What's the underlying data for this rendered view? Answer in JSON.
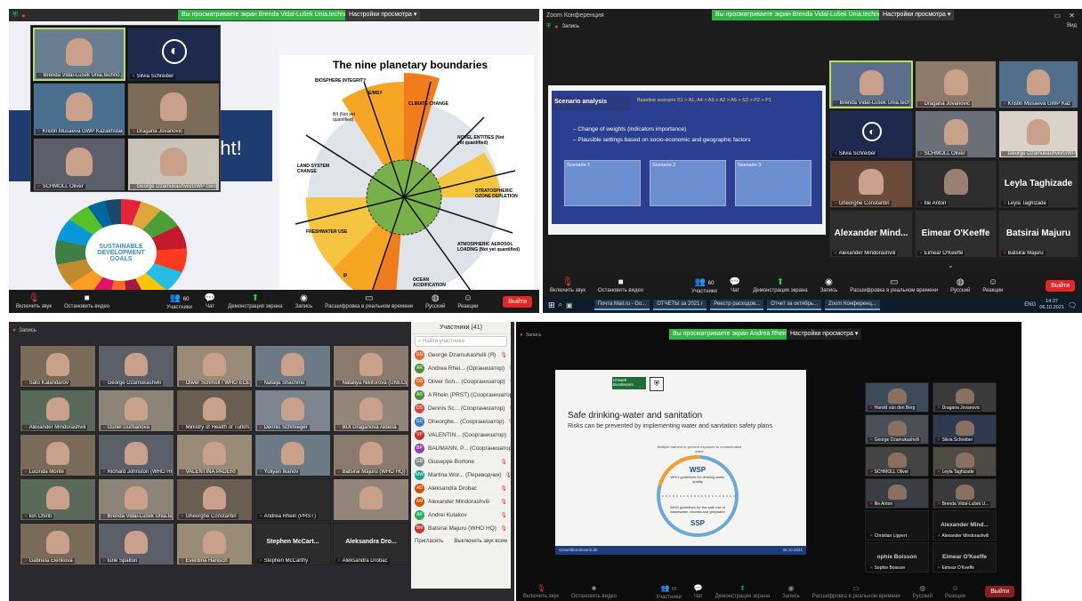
{
  "q1": {
    "share_banner": "Вы просматриваете экран Brenda Vidal-Lušek Unia.techno...",
    "share_settings": "Настройки просмотра ▾",
    "participants": [
      {
        "name": "Brenda Vidal-Lušek Unia.techno..."
      },
      {
        "name": "Silvia Schreiber"
      },
      {
        "name": "Kristin Musaeva GWP Kazakhstan"
      },
      {
        "name": "Dragana Jovanovic"
      },
      {
        "name": "SCHMOLL Oliver"
      },
      {
        "name": "George Dzamukashvili/GWP Geor..."
      }
    ],
    "slide": {
      "title": "The nine planetary boundaries",
      "labels": [
        "BIOSPHERE INTEGRITY",
        "E/MSY",
        "BII (Not yet quantified)",
        "CLIMATE CHANGE",
        "NOVEL ENTITIES (Not yet quantified)",
        "LAND-SYSTEM CHANGE",
        "STRATOSPHERIC OZONE DEPLETION",
        "FRESHWATER USE",
        "ATMOSPHERIC AEROSOL LOADING (Not yet quantified)",
        "OCEAN ACIDIFICATION",
        "P",
        "N"
      ],
      "partial_text": "ght!",
      "sdg": "SUSTAINABLE DEVELOPMENT GOALS"
    },
    "toolbar": {
      "mute": "Включить звук",
      "video": "Остановить видео",
      "participants": "Участники",
      "participants_count": "60",
      "chat": "Чат",
      "share": "Демонстрация экрана",
      "record": "Запись",
      "transcript": "Расшифровка в реальном времени",
      "lang": "Русский",
      "reactions": "Реакции",
      "leave": "Выйти"
    }
  },
  "q2": {
    "title": "Zoom Конференция",
    "share_banner": "Вы просматриваете экран Brenda Vidal-Lušek Unia.techno...",
    "share_settings": "Настройки просмотра ▾",
    "record": "Запись",
    "view": "Вид",
    "slide": {
      "title": "Scenario analysis",
      "baseline": "Baseline scenario S1 > A1, A4 > A3 > A2 > A5 > S2 > P2 > P1",
      "bullets": [
        "Change of weights (indicators importance)",
        "Plausible settings based on socio-economic and geographic factors"
      ],
      "scenarios": [
        "Scenario 1",
        "Scenario 2",
        "Scenario 3"
      ]
    },
    "participants": [
      {
        "name": "Brenda Vidal-Lušek Unia.techno..."
      },
      {
        "name": "Dragana Jovanovic"
      },
      {
        "name": "Kristin Musaeva GWP Kaz"
      },
      {
        "name": "Silvia Schreiber"
      },
      {
        "name": "SCHMOLL Oliver"
      },
      {
        "name": "George Dzamukashvili/GWP..."
      },
      {
        "name": "Gheorghe Constantin"
      },
      {
        "name": "Ilie Anton"
      },
      {
        "name": "Leyla Taghizade",
        "big": "Leyla Taghizade"
      },
      {
        "name": "Alexander Mindorashvili",
        "big": "Alexander Mind..."
      },
      {
        "name": "Eimear O'Keeffe",
        "big": "Eimear O'Keeffe"
      },
      {
        "name": "Batsirai Majuru",
        "big": "Batsirai Majuru"
      }
    ],
    "toolbar": {
      "mute": "Включить звук",
      "video": "Остановить видео",
      "participants": "Участники",
      "participants_count": "60",
      "chat": "Чат",
      "share": "Демонстрация экрана",
      "record": "Запись",
      "transcript": "Расшифровка в реальном времени",
      "lang": "Русский",
      "reactions": "Реакции",
      "leave": "Выйти"
    },
    "taskbar": {
      "apps": [
        "Почта Mail.ru - Go...",
        "ОТЧЕТЫ за 2021 г",
        "Реестр расходов...",
        "Отчет за октябрь...",
        "Zoom Конференц..."
      ],
      "lang": "ENG",
      "time": "14:37",
      "date": "06.10.2021"
    }
  },
  "q3": {
    "record": "Запись",
    "panel_title": "Участники (41)",
    "search_placeholder": "Найти участника",
    "panel_list": [
      {
        "initials": "GD",
        "name": "George Dzamukashvili (Я)",
        "color": "#e06c2c"
      },
      {
        "initials": "AR",
        "name": "Andrea Rhei... (Организатор)",
        "color": "#4a8f3c"
      },
      {
        "initials": "OS",
        "name": "Oliver Sch... (Соорганизатор)",
        "color": "#e06c2c"
      },
      {
        "initials": "AR",
        "name": "A Rhein (PRST) (Соорганизатор)",
        "color": "#4a8f3c"
      },
      {
        "initials": "DS",
        "name": "Dennis Sc... (Соорганизатор)",
        "color": "#d04a4a"
      },
      {
        "initials": "GC",
        "name": "Gheorghe... (Соорганизатор)",
        "color": "#3c7bc4"
      },
      {
        "initials": "VP",
        "name": "VALENTIN... (Соорганизатор)",
        "color": "#c0392b"
      },
      {
        "initials": "BP",
        "name": "BAUMANN, P... (Соорганизатор)",
        "color": "#8e44ad"
      },
      {
        "initials": "GB",
        "name": "Giuseppe Borlone",
        "color": "#7f8c8d"
      },
      {
        "initials": "MW",
        "name": "Martina Wor... (Переводчик)",
        "color": "#16a085"
      },
      {
        "initials": "AD",
        "name": "Aleksandra Drobac",
        "color": "#d35400"
      },
      {
        "initials": "AM",
        "name": "Alexander Mindorashvili",
        "color": "#d35400"
      },
      {
        "initials": "AK",
        "name": "Andrei Kulakov",
        "color": "#27ae60"
      },
      {
        "initials": "BM",
        "name": "Batsirai Majuru (WHO HQ)",
        "color": "#c0392b"
      }
    ],
    "invite": "Пригласить",
    "mute_all": "Выключить звук всем",
    "grid": [
      "Safo Kalandarov",
      "George Dzamukashvili",
      "Oliver Schmoll / WHO ECEH",
      "Natalja Shachmu",
      "Nataliya Nikiforova (UNECE)",
      "Alexander Mindorashvili",
      "Gunel Gurbanova",
      "Ministry of Health of Turkm...",
      "Dennis Schmieger",
      "BUI Draganova Aldena",
      "Lucinda Monte",
      "Richard Johnston (WHO HQ)",
      "VALENTINA PADERI",
      "Yuliyan Ikanov",
      "Batsirai Majuru (WHO HQ)",
      "Ion Chiriti",
      "Brenda Vidal-Lušek Unia.tech...",
      "Gheorghe Constantin",
      "Andrea Rhein (PRST)",
      "",
      "Gabriela Elenkova",
      "Iurie Spalton",
      "Everdina Hanisch",
      "Stephen McCarthy",
      "Aleksandra Drobac"
    ],
    "grid_big": {
      "18": "",
      "23": "Stephen McCart...",
      "24": "Aleksandra Dro..."
    }
  },
  "q4": {
    "share_banner": "Вы просматриваете экран Andrea Rhein",
    "share_settings": "Настройки просмотра ▾",
    "record": "Запись",
    "slide": {
      "logo1": "Umwelt Bundesamt",
      "title": "Safe drinking-water and sanitation",
      "subtitle": "Risks can be prevented by implementing water and sanitation safety plans",
      "cycle_top": "Multiple barriers to prevent exposure to contaminated water",
      "wsp": "WSP",
      "wsp_sub": "WHO guidelines for drinking-water quality",
      "ssp": "SSP",
      "ssp_sub": "WHO guidelines for the safe use of wastewater, excreta and greywater",
      "footer": "Umweltbundesamt.de",
      "page": "25.10.2021"
    },
    "participants": [
      {
        "name": "Harold van den Berg"
      },
      {
        "name": "Dragana Jovanovic"
      },
      {
        "name": "George Dzamukashvili"
      },
      {
        "name": "Silvia Schreiber"
      },
      {
        "name": "SCHMOLL Oliver"
      },
      {
        "name": "Leyla Taghizade"
      },
      {
        "name": "Ilie Anton"
      },
      {
        "name": "Brenda Vidal-Lušek U..."
      },
      {
        "name": "Christian Lippert",
        "big": ""
      },
      {
        "name": "Alexander Mindorashvili",
        "big": "Alexander Mind..."
      },
      {
        "name": "Sophie Boisson",
        "big": "ophie Boisson"
      },
      {
        "name": "Eimear O'Keeffe",
        "big": "Eimear O'Keeffe"
      }
    ],
    "toolbar": {
      "mute": "Включить звук",
      "video": "Остановить видео",
      "participants": "Участники",
      "participants_count": "60",
      "chat": "Чат",
      "share": "Демонстрация экрана",
      "record": "Запись",
      "transcript": "Расшифровка в реальном времени",
      "lang": "Русский",
      "reactions": "Реакции",
      "leave": "Выйти"
    }
  }
}
